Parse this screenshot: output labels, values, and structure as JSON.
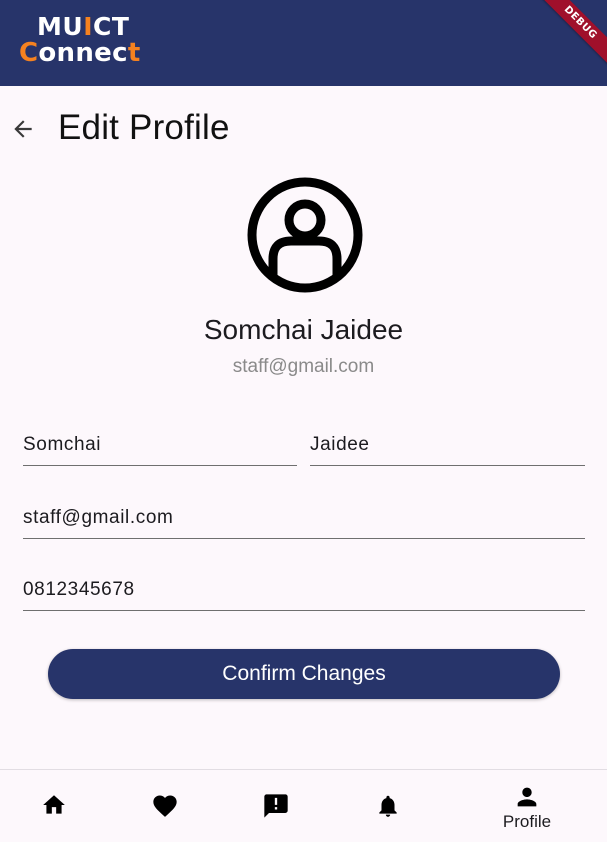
{
  "app": {
    "logo_top_a": "MU",
    "logo_top_b": "I",
    "logo_top_c": "CT",
    "logo_bottom_a": "C",
    "logo_bottom_b": "onnec",
    "logo_bottom_c": "t",
    "debug_banner": "DEBUG"
  },
  "header": {
    "title": "Edit Profile",
    "back_icon": "arrow-left-icon"
  },
  "profile": {
    "avatar_icon": "account-circle-icon",
    "name": "Somchai Jaidee",
    "email": "staff@gmail.com"
  },
  "form": {
    "first_name": "Somchai",
    "last_name": "Jaidee",
    "email": "staff@gmail.com",
    "phone": "0812345678",
    "confirm_label": "Confirm Changes"
  },
  "nav": {
    "items": [
      {
        "icon": "home-icon",
        "label": ""
      },
      {
        "icon": "heart-icon",
        "label": ""
      },
      {
        "icon": "report-icon",
        "label": ""
      },
      {
        "icon": "bell-icon",
        "label": ""
      },
      {
        "icon": "person-icon",
        "label": "Profile"
      }
    ]
  },
  "colors": {
    "primary": "#27346a",
    "accent": "#f58220",
    "debug": "#a0102b",
    "background": "#fdf8fc"
  }
}
